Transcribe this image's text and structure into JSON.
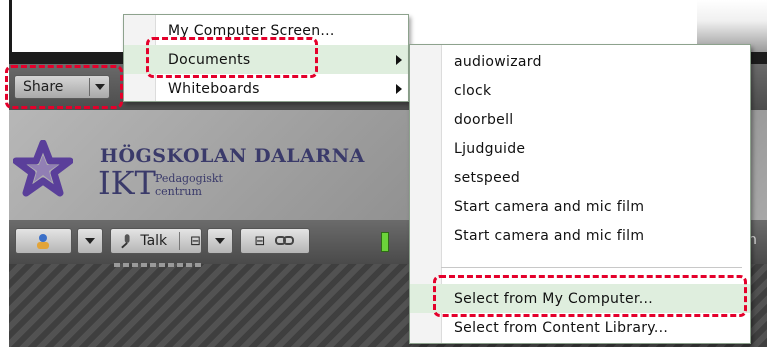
{
  "share": {
    "label": "Share"
  },
  "logo": {
    "title": "HÖGSKOLAN DALARNA",
    "ikt": "IKT",
    "sub_line1": "Pedagogiskt",
    "sub_line2": "centrum"
  },
  "toolbar": {
    "talk_label": "Talk",
    "right_letter": "n"
  },
  "share_menu": {
    "items": [
      {
        "label": "My Computer Screen..."
      },
      {
        "label": "Documents"
      },
      {
        "label": "Whiteboards"
      }
    ]
  },
  "documents_menu": {
    "items": [
      {
        "label": "audiowizard"
      },
      {
        "label": "clock"
      },
      {
        "label": "doorbell"
      },
      {
        "label": "Ljudguide"
      },
      {
        "label": "setspeed"
      },
      {
        "label": "Start camera and mic film"
      },
      {
        "label": "Start camera and mic film"
      }
    ],
    "actions": [
      {
        "label": "Select from My Computer..."
      },
      {
        "label": "Select from Content Library..."
      }
    ]
  },
  "colors": {
    "highlight_row": "#dfeede",
    "annotation_red": "#e4002b",
    "logo_text": "#3a3a6a",
    "star_purple": "#5a3f9a"
  },
  "icons": [
    "chevron-down-icon",
    "submenu-arrow-icon",
    "star-logo",
    "attendee-icon",
    "microphone-icon",
    "camera-icon",
    "link-icon"
  ]
}
